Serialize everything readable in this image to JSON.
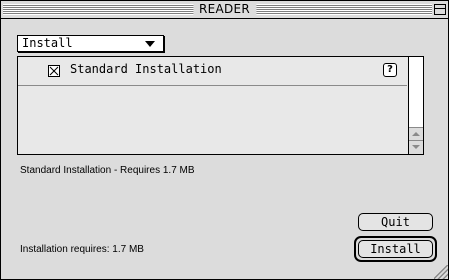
{
  "window": {
    "title": "READER"
  },
  "install_popup": {
    "selected": "Install"
  },
  "components_list": {
    "items": [
      {
        "label": "Standard Installation",
        "checked": true,
        "mark": "☒",
        "help": "?"
      }
    ]
  },
  "description": "Standard Installation - Requires 1.7 MB",
  "install_requirement": "Installation requires: 1.7 MB",
  "buttons": {
    "quit": "Quit",
    "install": "Install"
  },
  "icons": {
    "zoom": "zoom-box-icon",
    "popup_arrow": "chevron-down-icon",
    "help": "help-icon",
    "scroll_up": "scroll-up-arrow-icon",
    "scroll_down": "scroll-down-arrow-icon",
    "grow": "resize-grip-icon"
  }
}
